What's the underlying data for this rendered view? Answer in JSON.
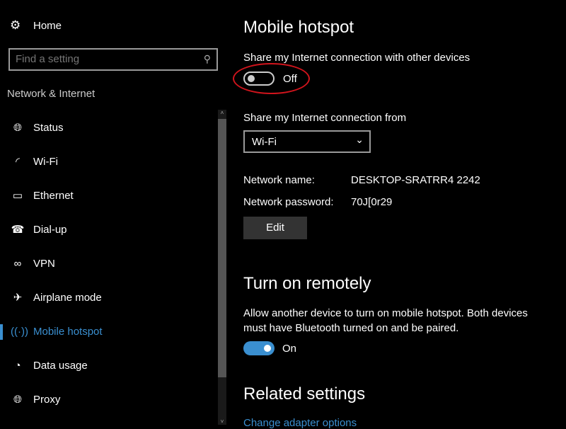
{
  "sidebar": {
    "home": "Home",
    "search_placeholder": "Find a setting",
    "section": "Network & Internet",
    "items": [
      {
        "label": "Status",
        "icon": "globe-monitor-icon"
      },
      {
        "label": "Wi-Fi",
        "icon": "wifi-icon"
      },
      {
        "label": "Ethernet",
        "icon": "ethernet-icon"
      },
      {
        "label": "Dial-up",
        "icon": "phone-icon"
      },
      {
        "label": "VPN",
        "icon": "vpn-icon"
      },
      {
        "label": "Airplane mode",
        "icon": "airplane-icon"
      },
      {
        "label": "Mobile hotspot",
        "icon": "hotspot-icon",
        "active": true
      },
      {
        "label": "Data usage",
        "icon": "pie-chart-icon"
      },
      {
        "label": "Proxy",
        "icon": "globe-icon"
      }
    ]
  },
  "main": {
    "title": "Mobile hotspot",
    "share_label": "Share my Internet connection with other devices",
    "share_state": "Off",
    "share_from_label": "Share my Internet connection from",
    "share_from_value": "Wi-Fi",
    "network_name_label": "Network name:",
    "network_name": "DESKTOP-SRATRR4 2242",
    "network_password_label": "Network password:",
    "network_password": "70J[0r29",
    "edit": "Edit",
    "remote_title": "Turn on remotely",
    "remote_desc1": "Allow another device to turn on mobile hotspot. Both devices",
    "remote_desc2": "must have Bluetooth turned on and be paired.",
    "remote_state": "On",
    "related_title": "Related settings",
    "related_link": "Change adapter options"
  },
  "colors": {
    "accent": "#3a8fd0",
    "annotation": "#d0141c"
  }
}
